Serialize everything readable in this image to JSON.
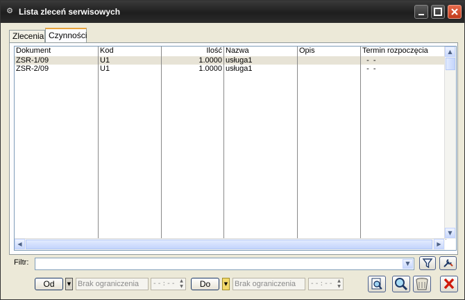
{
  "window": {
    "title": "Lista zleceń serwisowych"
  },
  "tabs": [
    {
      "label": "Zlecenia",
      "active": false
    },
    {
      "label": "Czynności",
      "active": true
    }
  ],
  "table": {
    "columns": [
      "Dokument",
      "Kod",
      "Ilość",
      "Nazwa",
      "Opis",
      "Termin rozpoczęcia"
    ],
    "rows": [
      {
        "dokument": "ZSR-1/09",
        "kod": "U1",
        "ilosc": "1.0000",
        "nazwa": "usługa1",
        "opis": "",
        "termin": "  -  -",
        "selected": true
      },
      {
        "dokument": "ZSR-2/09",
        "kod": "U1",
        "ilosc": "1.0000",
        "nazwa": "usługa1",
        "opis": "",
        "termin": "  -  -",
        "selected": false
      }
    ]
  },
  "filter": {
    "label": "Filtr:",
    "value": ""
  },
  "range": {
    "od_label": "Od",
    "do_label": "Do",
    "od_placeholder": "Brak ograniczenia",
    "do_placeholder": "Brak ograniczenia",
    "od_time": "- - : - -",
    "do_time": "- - : - -"
  },
  "icons": {
    "filter": "funnel-icon",
    "settings": "wrench-icon",
    "preview": "document-preview-icon",
    "search": "magnifier-icon",
    "trash": "trash-bin-icon",
    "close": "red-x-icon"
  }
}
